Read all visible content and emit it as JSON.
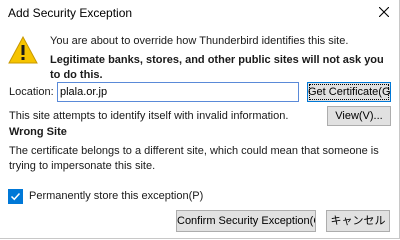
{
  "window": {
    "title": "Add Security Exception",
    "close_glyph": "×"
  },
  "intro": {
    "line1": "You are about to override how Thunderbird identifies this site.",
    "line2": "Legitimate banks, stores, and other public sites will not ask you to do this."
  },
  "location": {
    "label": "Location:",
    "value": "plala.or.jp",
    "get_certificate_label": "Get Certificate(G)"
  },
  "status": {
    "text": "This site attempts to identify itself with invalid information.",
    "view_label": "View(V)..."
  },
  "wrong_site": {
    "title": "Wrong Site",
    "body": "The certificate belongs to a different site, which could mean that someone is trying to impersonate this site."
  },
  "permanent": {
    "label": "Permanently store this exception(P)",
    "checked": true
  },
  "actions": {
    "confirm_label": "Confirm Security Exception(C)",
    "cancel_label": "キャンセル"
  },
  "colors": {
    "accent": "#0078d7",
    "warning": "#f6c400"
  },
  "icons": {
    "warning": "warning-triangle-icon",
    "close": "close-icon",
    "check": "checkmark-icon"
  }
}
